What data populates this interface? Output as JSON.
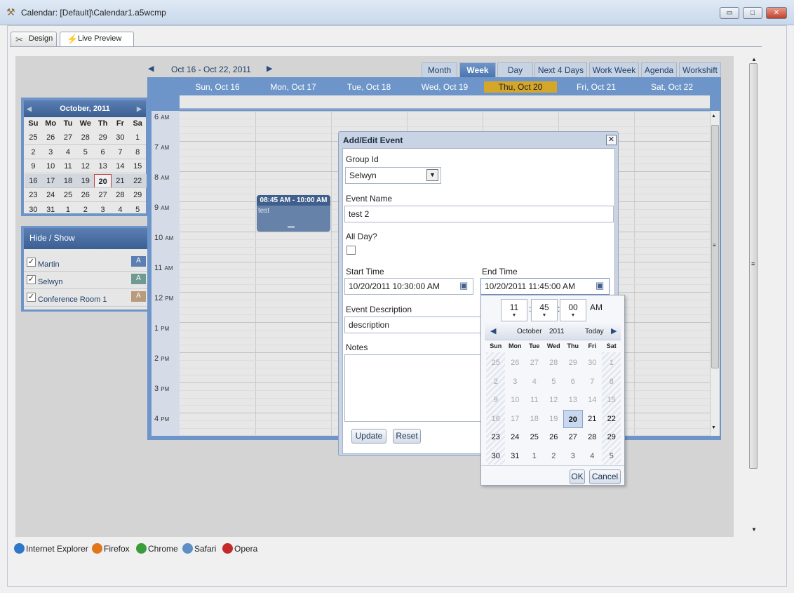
{
  "window": {
    "title": "Calendar: [Default]\\Calendar1.a5wcmp",
    "min_glyph": "▭",
    "max_glyph": "□",
    "close_glyph": "✕"
  },
  "tabs": [
    {
      "label": "Design"
    },
    {
      "label": "Live Preview"
    }
  ],
  "calendar": {
    "range_label": "Oct 16 - Oct 22, 2011",
    "views": [
      "Month",
      "Week",
      "Day",
      "Next 4 Days",
      "Work Week",
      "Agenda",
      "Workshift"
    ],
    "active_view": "Week",
    "days": [
      "Sun, Oct 16",
      "Mon, Oct 17",
      "Tue, Oct 18",
      "Wed, Oct 19",
      "Thu, Oct 20",
      "Fri, Oct 21",
      "Sat, Oct 22"
    ],
    "today_index": 4,
    "today_color": "#d4a62a",
    "hours": [
      {
        "h": "6",
        "ap": "AM"
      },
      {
        "h": "7",
        "ap": "AM"
      },
      {
        "h": "8",
        "ap": "AM"
      },
      {
        "h": "9",
        "ap": "AM"
      },
      {
        "h": "10",
        "ap": "AM"
      },
      {
        "h": "11",
        "ap": "AM"
      },
      {
        "h": "12",
        "ap": "PM"
      },
      {
        "h": "1",
        "ap": "PM"
      },
      {
        "h": "2",
        "ap": "PM"
      },
      {
        "h": "3",
        "ap": "PM"
      },
      {
        "h": "4",
        "ap": "PM"
      }
    ],
    "event": {
      "time": "08:45 AM - 10:00 AM",
      "name": "test"
    }
  },
  "mini_calendar": {
    "title": "October, 2011",
    "weekdays": [
      "Su",
      "Mo",
      "Tu",
      "We",
      "Th",
      "Fr",
      "Sa"
    ],
    "weeks": [
      [
        "25",
        "26",
        "27",
        "28",
        "29",
        "30",
        "1"
      ],
      [
        "2",
        "3",
        "4",
        "5",
        "6",
        "7",
        "8"
      ],
      [
        "9",
        "10",
        "11",
        "12",
        "13",
        "14",
        "15"
      ],
      [
        "16",
        "17",
        "18",
        "19",
        "20",
        "21",
        "22"
      ],
      [
        "23",
        "24",
        "25",
        "26",
        "27",
        "28",
        "29"
      ],
      [
        "30",
        "31",
        "1",
        "2",
        "3",
        "4",
        "5"
      ]
    ],
    "selected": "20"
  },
  "hide_show": {
    "title": "Hide / Show",
    "items": [
      {
        "label": "Martin",
        "checked": true,
        "badge": "A",
        "color": "#5b7fb2"
      },
      {
        "label": "Selwyn",
        "checked": true,
        "badge": "A",
        "color": "#6f9a91"
      },
      {
        "label": "Conference Room 1",
        "checked": true,
        "badge": "A",
        "color": "#b89a7c"
      }
    ]
  },
  "dialog": {
    "title": "Add/Edit Event",
    "group_label": "Group Id",
    "group_value": "Selwyn",
    "name_label": "Event Name",
    "name_value": "test 2",
    "allday_label": "All Day?",
    "start_label": "Start Time",
    "start_value": "10/20/2011 10:30:00 AM",
    "end_label": "End Time",
    "end_value": "10/20/2011 11:45:00 AM",
    "desc_label": "Event Description",
    "desc_value": "description",
    "notes_label": "Notes",
    "update_label": "Update",
    "reset_label": "Reset"
  },
  "picker": {
    "hour": "11",
    "minute": "45",
    "second": "00",
    "ampm": "AM",
    "month": "October",
    "year": "2011",
    "today_label": "Today",
    "weekdays": [
      "Sun",
      "Mon",
      "Tue",
      "Wed",
      "Thu",
      "Fri",
      "Sat"
    ],
    "weeks": [
      [
        "25",
        "26",
        "27",
        "28",
        "29",
        "30",
        "1"
      ],
      [
        "2",
        "3",
        "4",
        "5",
        "6",
        "7",
        "8"
      ],
      [
        "9",
        "10",
        "11",
        "12",
        "13",
        "14",
        "15"
      ],
      [
        "16",
        "17",
        "18",
        "19",
        "20",
        "21",
        "22"
      ],
      [
        "23",
        "24",
        "25",
        "26",
        "27",
        "28",
        "29"
      ],
      [
        "30",
        "31",
        "1",
        "2",
        "3",
        "4",
        "5"
      ]
    ],
    "disabled_rows": 3,
    "disabled_first": 4,
    "selected": "20",
    "ok_label": "OK",
    "cancel_label": "Cancel"
  },
  "browsers": [
    {
      "label": "Internet Explorer",
      "color": "#2f77c8"
    },
    {
      "label": "Firefox",
      "color": "#e0751c"
    },
    {
      "label": "Chrome",
      "color": "#3a9d3a"
    },
    {
      "label": "Safari",
      "color": "#5d8fc4"
    },
    {
      "label": "Opera",
      "color": "#c42a2a"
    }
  ]
}
